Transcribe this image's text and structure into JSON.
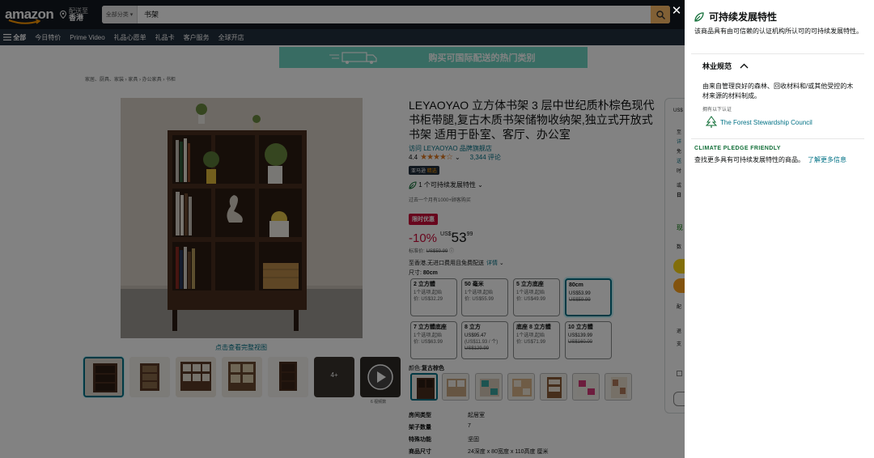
{
  "header": {
    "logo_text": "amazon",
    "deliver_line1": "配送至",
    "deliver_line2": "香港",
    "search_category": "全部分类",
    "search_query": "书架"
  },
  "nav": {
    "all": "全部",
    "items": [
      "今日特价",
      "Prime Video",
      "礼品心愿单",
      "礼品卡",
      "客户服务",
      "全球开店"
    ]
  },
  "banner": {
    "text": "购买可国际配送的热门类别"
  },
  "breadcrumb": "家居、厨具、家装 › 家具 › 办公家具 › 书柜",
  "gallery": {
    "full_view": "点击查看完整视图",
    "more_count": "4+",
    "video_label": "6 视频数"
  },
  "product": {
    "title": "LEYAOYAO 立方体书架 3 层中世纪质朴棕色现代书柜带腿,复古木质书架储物收纳架,独立式开放式书架 适用于卧室、客厅、办公室",
    "store": "访问 LEYAOYAO 品牌旗舰店",
    "rating_value": "4.4",
    "stars_fraction": 0.88,
    "review_count": "3,344 评论",
    "choice_badge_1": "亚马逊",
    "choice_badge_2": "精选",
    "sustain_text": "1 个可持续发展特性",
    "bought": "过去一个月有1000+顾客购买",
    "deal_badge": "限时优惠",
    "discount": "-10%",
    "currency": "US$",
    "price_whole": "53",
    "price_cents": "99",
    "list_price_label": "标准价:",
    "list_price": "US$59.99",
    "shipping": "至香港,无进口费用且免费配送",
    "shipping_link": "详情",
    "size_label": "尺寸:",
    "size_value": "80cm",
    "color_label": "颜色:",
    "color_value": "复古棕色"
  },
  "size_options": [
    {
      "name": "2 立方體",
      "l1": "1个选项,起始",
      "l2": "价: US$32.29",
      "l3": ""
    },
    {
      "name": "50 毫米",
      "l1": "1个选项,起始",
      "l2": "价: US$55.99",
      "l3": ""
    },
    {
      "name": "5 立方底座",
      "l1": "1个选项,起始",
      "l2": "价: US$49.99",
      "l3": ""
    },
    {
      "name": "80cm",
      "l1": "US$53.99",
      "l2": "US$59.99",
      "l3": ""
    },
    {
      "name": "7 立方體底座",
      "l1": "1个选项,起始",
      "l2": "价: US$63.99",
      "l3": ""
    },
    {
      "name": "8 立方",
      "l1": "US$95.47",
      "l2": "(US$11.93 / 个)",
      "l3": "US$129.99"
    },
    {
      "name": "底座 8 立方體",
      "l1": "1个选项,起始",
      "l2": "价: US$71.99",
      "l3": ""
    },
    {
      "name": "10 立方體",
      "l1": "US$139.99",
      "l2": "US$160.00",
      "l3": ""
    }
  ],
  "specs": [
    {
      "k": "房间类型",
      "v": "起居室"
    },
    {
      "k": "架子数量",
      "v": "7"
    },
    {
      "k": "特殊功能",
      "v": "坚固"
    },
    {
      "k": "商品尺寸",
      "v": "24深度 x 80宽度 x 110高度 厘米"
    }
  ],
  "buybox_text": [
    "US$",
    "至",
    "详",
    "免",
    "送",
    "时",
    "或",
    "日",
    "现",
    "数",
    "配",
    "退",
    "支"
  ],
  "panel": {
    "title": "可持续发展特性",
    "description": "该商品具有由可信赖的认证机构所认可的可持续发展特性。",
    "section_title": "林业规范",
    "section_desc": "由来自管理良好的森林、回收材料和/或其他受控的木材来源的材料制成。",
    "certified_by": "拥有以下认证",
    "cert_name": "The Forest Stewardship Council",
    "cpf_label": "CLIMATE PLEDGE FRIENDLY",
    "cpf_desc": "查找更多具有可持续发展特性的商品。",
    "cpf_link": "了解更多信息"
  },
  "colors": {
    "header_bg": "#131921",
    "nav_bg": "#232f3e",
    "search_btn": "#febd69",
    "link": "#007185",
    "deal": "#cc0c39",
    "star": "#de7921",
    "banner": "#6fd5c2",
    "cpf_green": "#14703a"
  },
  "icons": [
    "map-pin-icon",
    "search-icon",
    "menu-icon",
    "truck-icon",
    "share-icon",
    "play-icon",
    "leaf-icon",
    "chevron-up-icon",
    "chevron-down-icon",
    "tree-icon",
    "close-icon"
  ]
}
